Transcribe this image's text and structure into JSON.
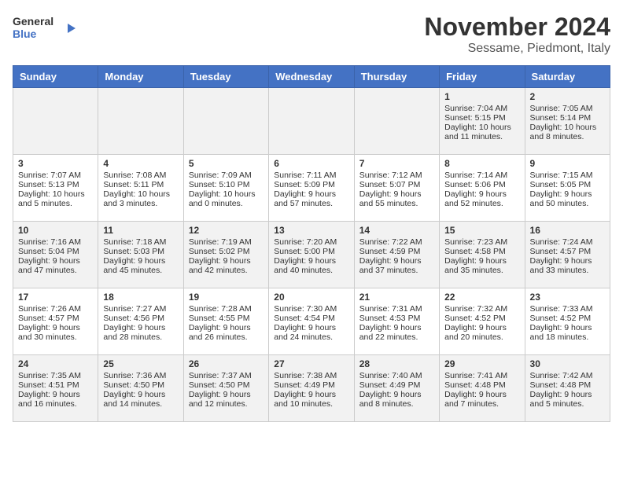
{
  "header": {
    "logo_line1": "General",
    "logo_line2": "Blue",
    "title": "November 2024",
    "subtitle": "Sessame, Piedmont, Italy"
  },
  "days_of_week": [
    "Sunday",
    "Monday",
    "Tuesday",
    "Wednesday",
    "Thursday",
    "Friday",
    "Saturday"
  ],
  "weeks": [
    [
      {
        "day": "",
        "info": ""
      },
      {
        "day": "",
        "info": ""
      },
      {
        "day": "",
        "info": ""
      },
      {
        "day": "",
        "info": ""
      },
      {
        "day": "",
        "info": ""
      },
      {
        "day": "1",
        "info": "Sunrise: 7:04 AM\nSunset: 5:15 PM\nDaylight: 10 hours and 11 minutes."
      },
      {
        "day": "2",
        "info": "Sunrise: 7:05 AM\nSunset: 5:14 PM\nDaylight: 10 hours and 8 minutes."
      }
    ],
    [
      {
        "day": "3",
        "info": "Sunrise: 7:07 AM\nSunset: 5:13 PM\nDaylight: 10 hours and 5 minutes."
      },
      {
        "day": "4",
        "info": "Sunrise: 7:08 AM\nSunset: 5:11 PM\nDaylight: 10 hours and 3 minutes."
      },
      {
        "day": "5",
        "info": "Sunrise: 7:09 AM\nSunset: 5:10 PM\nDaylight: 10 hours and 0 minutes."
      },
      {
        "day": "6",
        "info": "Sunrise: 7:11 AM\nSunset: 5:09 PM\nDaylight: 9 hours and 57 minutes."
      },
      {
        "day": "7",
        "info": "Sunrise: 7:12 AM\nSunset: 5:07 PM\nDaylight: 9 hours and 55 minutes."
      },
      {
        "day": "8",
        "info": "Sunrise: 7:14 AM\nSunset: 5:06 PM\nDaylight: 9 hours and 52 minutes."
      },
      {
        "day": "9",
        "info": "Sunrise: 7:15 AM\nSunset: 5:05 PM\nDaylight: 9 hours and 50 minutes."
      }
    ],
    [
      {
        "day": "10",
        "info": "Sunrise: 7:16 AM\nSunset: 5:04 PM\nDaylight: 9 hours and 47 minutes."
      },
      {
        "day": "11",
        "info": "Sunrise: 7:18 AM\nSunset: 5:03 PM\nDaylight: 9 hours and 45 minutes."
      },
      {
        "day": "12",
        "info": "Sunrise: 7:19 AM\nSunset: 5:02 PM\nDaylight: 9 hours and 42 minutes."
      },
      {
        "day": "13",
        "info": "Sunrise: 7:20 AM\nSunset: 5:00 PM\nDaylight: 9 hours and 40 minutes."
      },
      {
        "day": "14",
        "info": "Sunrise: 7:22 AM\nSunset: 4:59 PM\nDaylight: 9 hours and 37 minutes."
      },
      {
        "day": "15",
        "info": "Sunrise: 7:23 AM\nSunset: 4:58 PM\nDaylight: 9 hours and 35 minutes."
      },
      {
        "day": "16",
        "info": "Sunrise: 7:24 AM\nSunset: 4:57 PM\nDaylight: 9 hours and 33 minutes."
      }
    ],
    [
      {
        "day": "17",
        "info": "Sunrise: 7:26 AM\nSunset: 4:57 PM\nDaylight: 9 hours and 30 minutes."
      },
      {
        "day": "18",
        "info": "Sunrise: 7:27 AM\nSunset: 4:56 PM\nDaylight: 9 hours and 28 minutes."
      },
      {
        "day": "19",
        "info": "Sunrise: 7:28 AM\nSunset: 4:55 PM\nDaylight: 9 hours and 26 minutes."
      },
      {
        "day": "20",
        "info": "Sunrise: 7:30 AM\nSunset: 4:54 PM\nDaylight: 9 hours and 24 minutes."
      },
      {
        "day": "21",
        "info": "Sunrise: 7:31 AM\nSunset: 4:53 PM\nDaylight: 9 hours and 22 minutes."
      },
      {
        "day": "22",
        "info": "Sunrise: 7:32 AM\nSunset: 4:52 PM\nDaylight: 9 hours and 20 minutes."
      },
      {
        "day": "23",
        "info": "Sunrise: 7:33 AM\nSunset: 4:52 PM\nDaylight: 9 hours and 18 minutes."
      }
    ],
    [
      {
        "day": "24",
        "info": "Sunrise: 7:35 AM\nSunset: 4:51 PM\nDaylight: 9 hours and 16 minutes."
      },
      {
        "day": "25",
        "info": "Sunrise: 7:36 AM\nSunset: 4:50 PM\nDaylight: 9 hours and 14 minutes."
      },
      {
        "day": "26",
        "info": "Sunrise: 7:37 AM\nSunset: 4:50 PM\nDaylight: 9 hours and 12 minutes."
      },
      {
        "day": "27",
        "info": "Sunrise: 7:38 AM\nSunset: 4:49 PM\nDaylight: 9 hours and 10 minutes."
      },
      {
        "day": "28",
        "info": "Sunrise: 7:40 AM\nSunset: 4:49 PM\nDaylight: 9 hours and 8 minutes."
      },
      {
        "day": "29",
        "info": "Sunrise: 7:41 AM\nSunset: 4:48 PM\nDaylight: 9 hours and 7 minutes."
      },
      {
        "day": "30",
        "info": "Sunrise: 7:42 AM\nSunset: 4:48 PM\nDaylight: 9 hours and 5 minutes."
      }
    ]
  ]
}
